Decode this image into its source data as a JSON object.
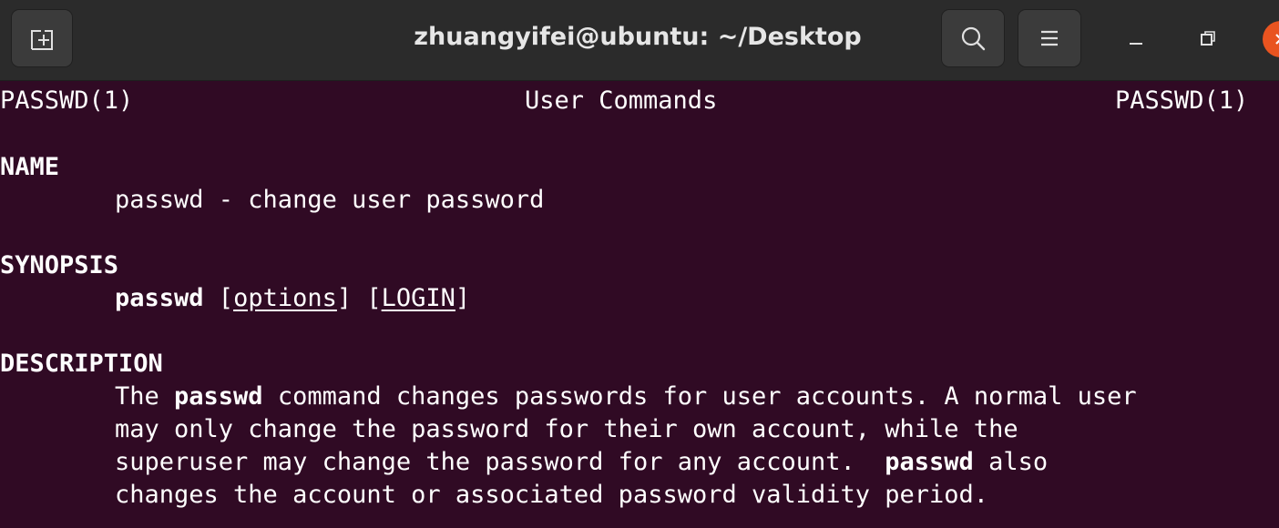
{
  "window": {
    "title": "zhuangyifei@ubuntu: ~/Desktop",
    "accent_close": "#e95420",
    "background": "#300a24"
  },
  "titlebar": {
    "new_tab_icon": "new-tab-icon",
    "search_icon": "search-icon",
    "menu_icon": "hamburger-menu-icon",
    "minimize_icon": "minimize-icon",
    "maximize_icon": "maximize-icon",
    "close_icon": "close-icon"
  },
  "man": {
    "header_left": "PASSWD(1)",
    "header_center": "User Commands",
    "header_right": "PASSWD(1)",
    "name_heading": "NAME",
    "name_text": "passwd - change user password",
    "synopsis_heading": "SYNOPSIS",
    "synopsis_cmd": "passwd",
    "synopsis_open1": " [",
    "synopsis_options": "options",
    "synopsis_close1": "]",
    "synopsis_open2": " [",
    "synopsis_login": "LOGIN",
    "synopsis_close2": "]",
    "description_heading": "DESCRIPTION",
    "desc_l1_a": "The ",
    "desc_l1_b": "passwd",
    "desc_l1_c": " command changes passwords for user accounts. A normal user",
    "desc_l2": "may only change the password for their own account, while the",
    "desc_l3_a": "superuser may change the password for any account.  ",
    "desc_l3_b": "passwd",
    "desc_l3_c": " also",
    "desc_l4": "changes the account or associated password validity period."
  }
}
